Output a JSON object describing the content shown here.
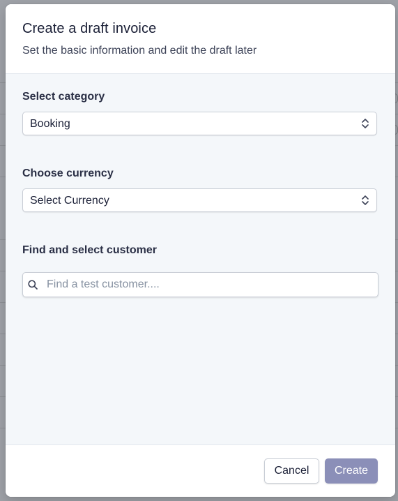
{
  "modal": {
    "title": "Create a draft invoice",
    "subtitle": "Set the basic information and edit the draft later"
  },
  "category": {
    "label": "Select category",
    "selected": "Booking"
  },
  "currency": {
    "label": "Choose currency",
    "selected": "Select Currency"
  },
  "customer": {
    "label": "Find and select customer",
    "placeholder": "Find a test customer....",
    "value": ""
  },
  "footer": {
    "cancel_label": "Cancel",
    "create_label": "Create"
  },
  "icons": {
    "category_select": "chevron-up-down-icon",
    "currency_select": "chevron-up-down-icon",
    "customer_search": "search-icon"
  },
  "colors": {
    "create_button_bg": "#8b8fb8",
    "body_bg": "#f4f7fa",
    "text_primary": "#1a1f36"
  }
}
